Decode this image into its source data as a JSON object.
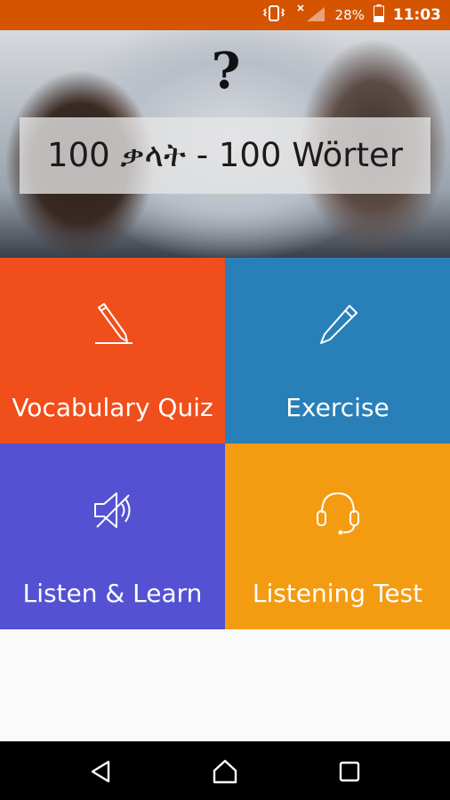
{
  "status_bar": {
    "battery_percent": "28%",
    "time": "11:03",
    "icons": [
      "vibrate-icon",
      "no-signal-icon",
      "battery-icon"
    ]
  },
  "header": {
    "icon": "question-mark-icon",
    "question_glyph": "?",
    "title": "100 ቃላት - 100 Wörter"
  },
  "tiles": [
    {
      "label": "Vocabulary Quiz",
      "icon": "pencil-underline-icon",
      "color": "#f04e1b"
    },
    {
      "label": "Exercise",
      "icon": "pencil-icon",
      "color": "#2980b9"
    },
    {
      "label": "Listen & Learn",
      "icon": "speaker-icon",
      "color": "#5452d2"
    },
    {
      "label": "Listening Test",
      "icon": "headphones-icon",
      "color": "#f39c12"
    }
  ],
  "nav_bar": {
    "buttons": [
      "back-icon",
      "home-icon",
      "recents-icon"
    ]
  },
  "colors": {
    "status_bar": "#d45400",
    "nav_bar": "#000000",
    "background": "#fafafa"
  }
}
